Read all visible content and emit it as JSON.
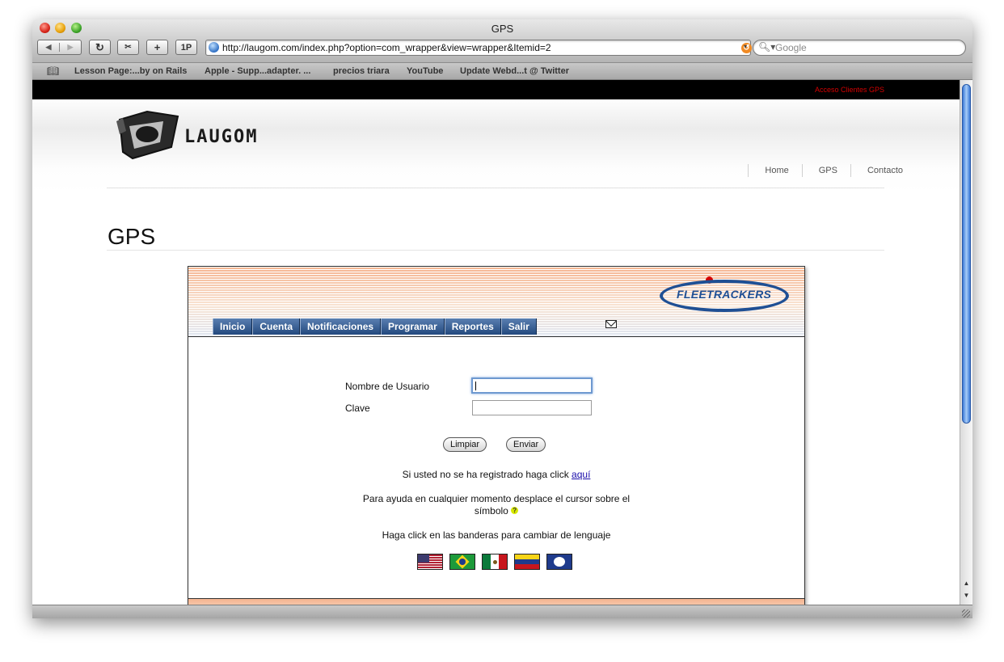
{
  "window": {
    "title": "GPS"
  },
  "toolbar": {
    "reload_icon": "reload-icon",
    "snapback_icon": "snapback-icon",
    "add_label": "+",
    "onepassword_label": "1P",
    "url": "http://laugom.com/index.php?option=com_wrapper&view=wrapper&Itemid=2",
    "search_placeholder": "Google"
  },
  "bookmarks": [
    "Lesson Page:...by on Rails",
    "Apple - Supp...adapter. ...",
    "precios triara",
    "YouTube",
    "Update Webd...t @ Twitter"
  ],
  "site": {
    "topbar_link": "Acceso Clientes GPS",
    "logo_text": "LAUGOM",
    "nav": [
      "Home",
      "GPS",
      "Contacto"
    ],
    "page_title": "GPS"
  },
  "fleet": {
    "brand": "FLEETRACKERS",
    "tabs": [
      "Inicio",
      "Cuenta",
      "Notificaciones",
      "Programar",
      "Reportes",
      "Salir"
    ],
    "form": {
      "username_label": "Nombre de Usuario",
      "username_value": "",
      "password_label": "Clave",
      "password_value": "",
      "clear_button": "Limpiar",
      "submit_button": "Enviar"
    },
    "register_text": "Si usted no se ha registrado haga click",
    "register_link": "aquí",
    "help_text_1": "Para ayuda en cualquier momento desplace el cursor sobre el",
    "help_text_2": "símbolo",
    "language_text": "Haga click en las banderas para cambiar de lenguaje",
    "flags": [
      "us-flag",
      "brazil-flag",
      "mexico-flag",
      "venezuela-flag",
      "puerto-rico-flag"
    ]
  }
}
